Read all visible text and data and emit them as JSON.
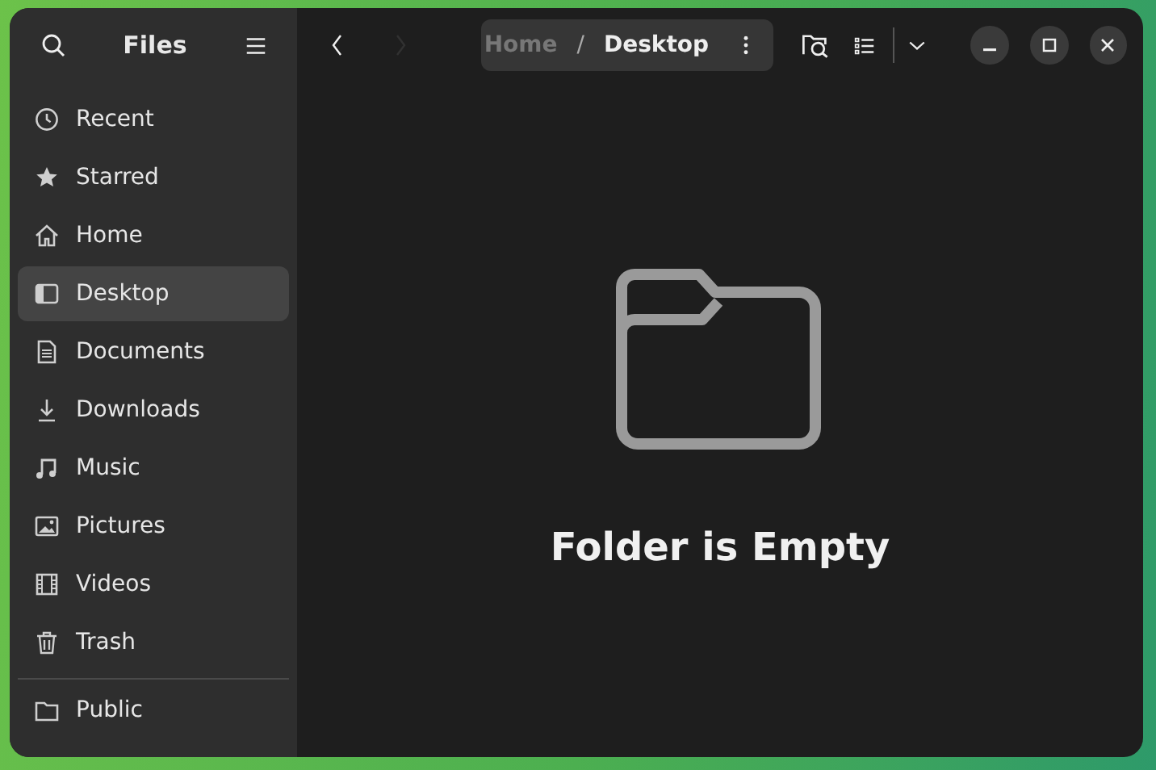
{
  "sidebar": {
    "title": "Files",
    "items": [
      {
        "label": "Recent",
        "selected": false
      },
      {
        "label": "Starred",
        "selected": false
      },
      {
        "label": "Home",
        "selected": false
      },
      {
        "label": "Desktop",
        "selected": true
      },
      {
        "label": "Documents",
        "selected": false
      },
      {
        "label": "Downloads",
        "selected": false
      },
      {
        "label": "Music",
        "selected": false
      },
      {
        "label": "Pictures",
        "selected": false
      },
      {
        "label": "Videos",
        "selected": false
      },
      {
        "label": "Trash",
        "selected": false
      }
    ],
    "other_items": [
      {
        "label": "Public",
        "selected": false
      }
    ]
  },
  "navigation": [
    {
      "kind": "back",
      "disabled": false
    },
    {
      "kind": "forward",
      "disabled": true
    }
  ],
  "path": {
    "separator": "/",
    "segments": [
      {
        "label": "Home",
        "current": false
      },
      {
        "label": "Desktop",
        "current": true
      }
    ]
  },
  "empty_state": {
    "title": "Folder is Empty"
  }
}
